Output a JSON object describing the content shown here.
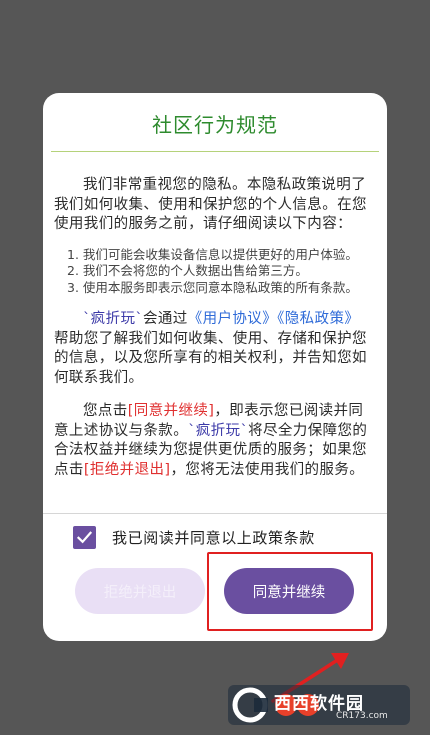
{
  "dialog": {
    "title": "社区行为规范",
    "intro": "我们非常重视您的隐私。本隐私政策说明了我们如何收集、使用和保护您的个人信息。在您使用我们的服务之前，请仔细阅读以下内容：",
    "list": [
      "1. 我们可能会收集设备信息以提供更好的用户体验。",
      "2. 我们不会将您的个人数据出售给第三方。",
      "3. 使用本服务即表示您同意本隐私政策的所有条款。"
    ],
    "para2": {
      "app_name": "`疯折玩`",
      "text_a": "会通过",
      "link_user": "《用户协议》",
      "link_privacy": "《隐私政策》",
      "text_b": "帮助您了解我们如何收集、使用、存储和保护您的信息，以及您所享有的相关权利，并告知您如何联系我们。"
    },
    "para3": {
      "text_a": "您点击",
      "agree_mark": "[同意并继续]",
      "text_b": "，即表示您已阅读并同意上述协议与条款。",
      "app_name": "`疯折玩`",
      "text_c": "将尽全力保障您的合法权益并继续为您提供更优质的服务；如果您点击",
      "refuse_mark": "[拒绝并退出]",
      "text_d": "，您将无法使用我们的服务。"
    },
    "agree_checkbox_label": "我已阅读并同意以上政策条款",
    "agree_checked": true,
    "refuse_button": "拒绝并退出",
    "agree_button": "同意并继续"
  },
  "watermark": {
    "brand": "西西软件园",
    "url": "CR173.com"
  },
  "colors": {
    "title": "#2e8b2e",
    "accent": "#6a4fa0",
    "link": "#2f6bd8",
    "highlight": "#e02020"
  }
}
